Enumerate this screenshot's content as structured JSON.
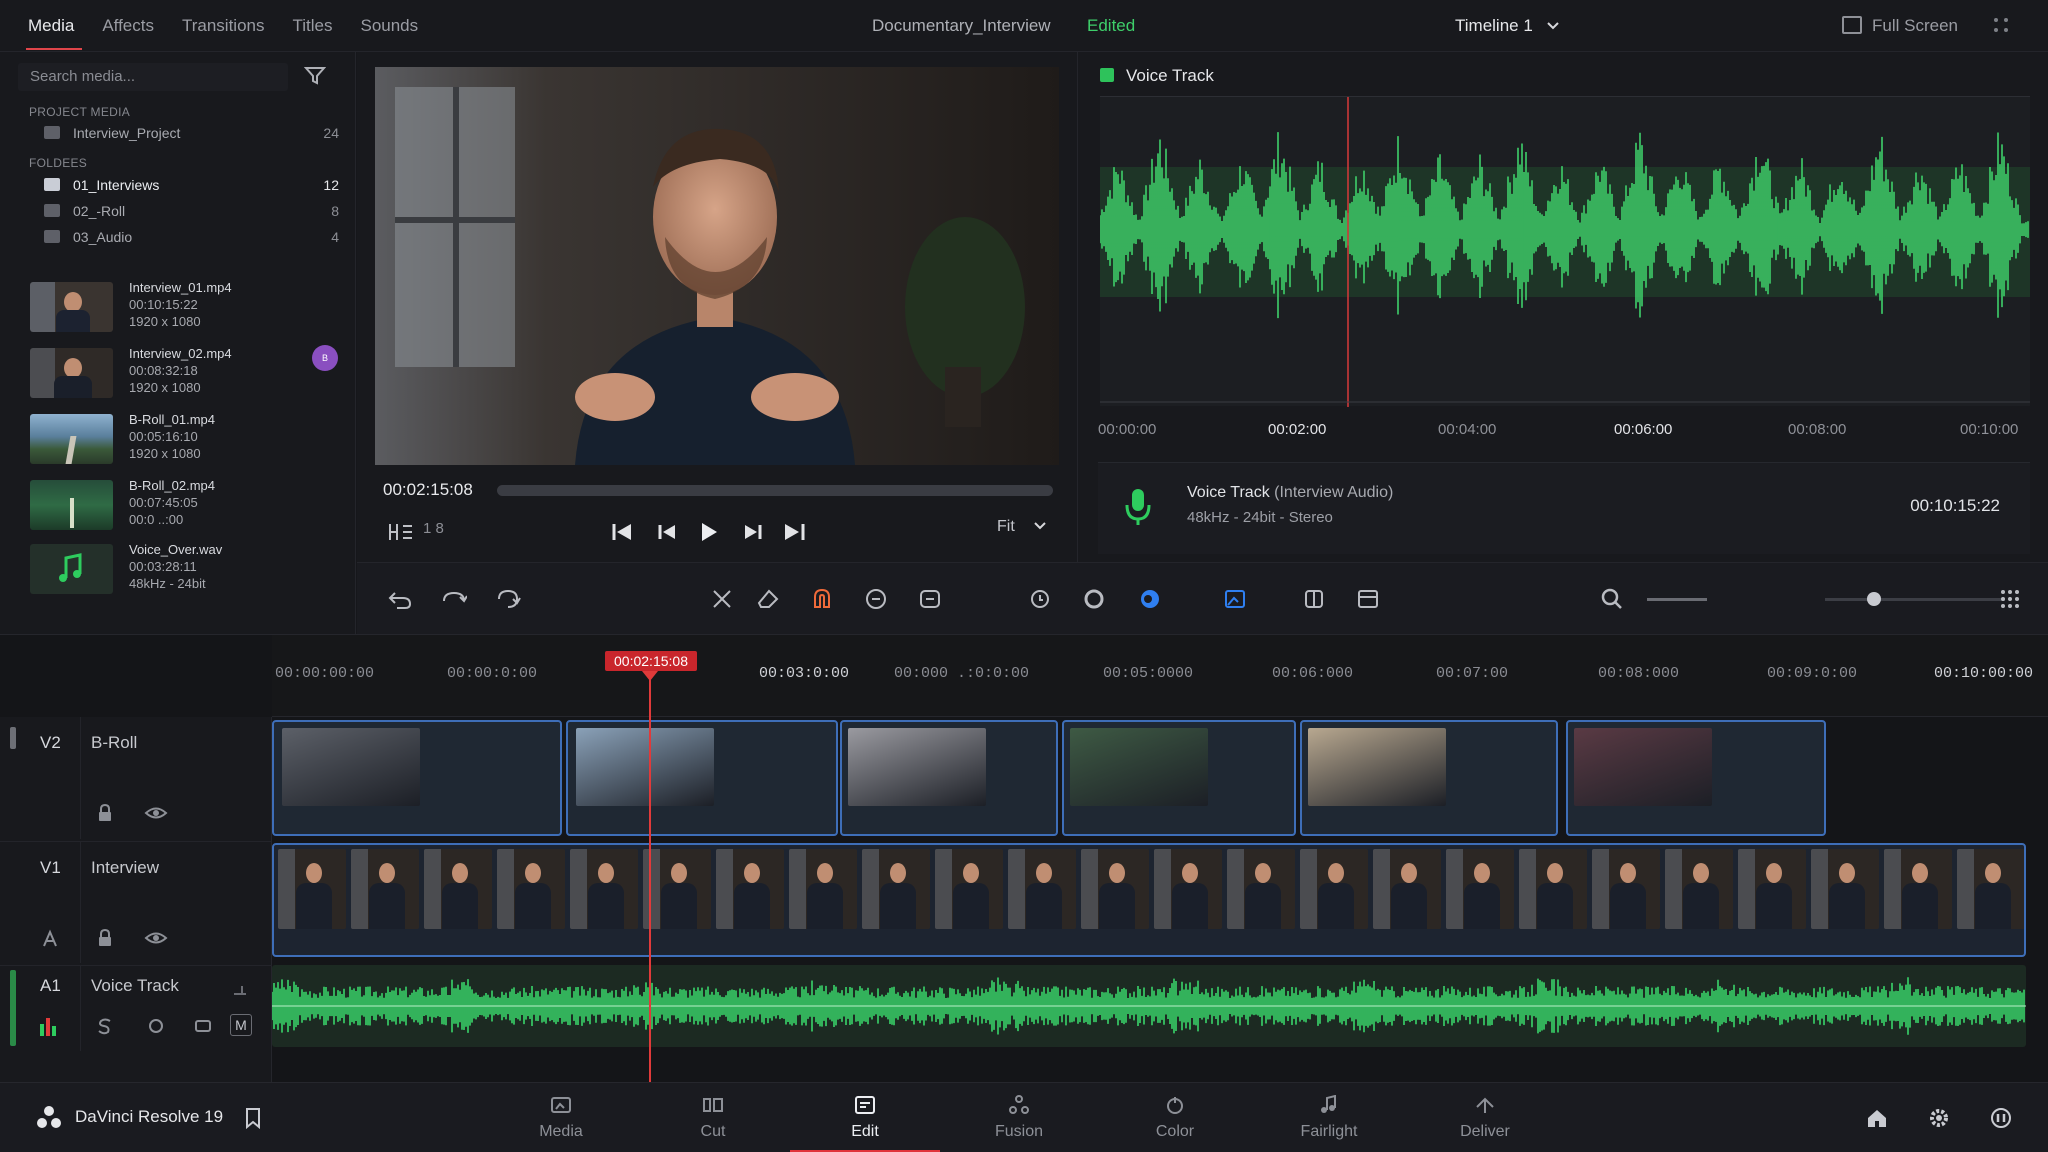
{
  "topbar": {
    "tabs": [
      "Media",
      "Affects",
      "Transitions",
      "Titles",
      "Sounds"
    ],
    "project_name": "Documentary_Interview",
    "status": "Edited",
    "timeline_selector": "Timeline 1",
    "full_screen": "Full Screen"
  },
  "media": {
    "search_placeholder": "Search media...",
    "project_media_label": "PROJECT MEDIA",
    "project": {
      "name": "Interview_Project",
      "count": "24"
    },
    "folders_label": "FOLDEES",
    "folders": [
      {
        "name": "01_Interviews",
        "count": "12"
      },
      {
        "name": "02_-Roll",
        "count": "8"
      },
      {
        "name": "03_Audio",
        "count": "4"
      }
    ],
    "clips": [
      {
        "name": "Interview_01.mp4",
        "duration": "00:10:15:22",
        "info": "1920 x 1080"
      },
      {
        "name": "Interview_02.mp4",
        "duration": "00:08:32:18",
        "info": "1920 x 1080"
      },
      {
        "name": "B-Roll_01.mp4",
        "duration": "00:05:16:10",
        "info": "1920 x 1080"
      },
      {
        "name": "B-Roll_02.mp4",
        "duration": "00:07:45:05",
        "info": "00:0 ..:00"
      },
      {
        "name": "Voice_Over.wav",
        "duration": "00:03:28:11",
        "info": "48kHz - 24bit"
      }
    ],
    "avatar_initial": "B"
  },
  "viewer": {
    "timecode": "00:02:15:08",
    "frame_label": "1 8",
    "zoom": "Fit",
    "progress": 0.0
  },
  "audio_view": {
    "title": "Voice Track",
    "time_labels": [
      "00:00:00",
      "00:02:00",
      "00:04:00",
      "00:06:00",
      "00:08:00",
      "00:10:00"
    ],
    "track_name": "Voice Track",
    "track_source": "(Interview Audio)",
    "track_format": "48kHz - 24bit - Stereo",
    "duration": "00:10:15:22",
    "accent": "#34c759"
  },
  "timeline": {
    "playhead_tc": "00:02:15:08",
    "ruler": [
      "00:00:00:00",
      "00:00:0:00",
      "00:03:0:00",
      "00:000 .:0:0:00",
      "00:05:0000",
      "00:06:000",
      "00:07:00",
      "00:08:000",
      "00:09:0:00",
      "00:10:00:00"
    ],
    "tracks": [
      {
        "id": "V2",
        "name": "B-Roll"
      },
      {
        "id": "V1",
        "name": "Interview"
      },
      {
        "id": "A1",
        "name": "Voice Track",
        "mute": "M"
      }
    ]
  },
  "bottom": {
    "app": "DaVinci Resolve 19",
    "pages": [
      "Media",
      "Cut",
      "Edit",
      "Fusion",
      "Color",
      "Fairlight",
      "Deliver"
    ],
    "active_page": "Edit"
  }
}
